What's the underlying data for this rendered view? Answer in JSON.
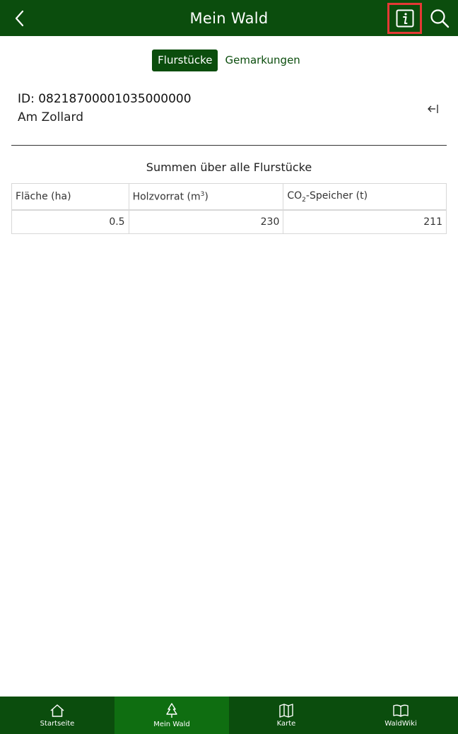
{
  "header": {
    "title": "Mein Wald",
    "back_icon": "chevron-left-icon",
    "info_icon": "info-icon",
    "search_icon": "search-icon"
  },
  "tabs": [
    {
      "label": "Flurstücke",
      "active": true
    },
    {
      "label": "Gemarkungen",
      "active": false
    }
  ],
  "parcel": {
    "id_text": "ID: 08218700001035000000",
    "name": "Am Zollard",
    "remove_icon": "remove-arrow-icon"
  },
  "summary": {
    "title": "Summen über alle Flurstücke",
    "columns": {
      "area": "Fläche (ha)",
      "wood_prefix": "Holzvorrat (m",
      "wood_sup": "3",
      "wood_suffix": ")",
      "co2_prefix": "CO",
      "co2_sub": "2",
      "co2_suffix": "-Speicher (t)"
    },
    "values": {
      "area": "0.5",
      "wood": "230",
      "co2": "211"
    }
  },
  "nav": [
    {
      "label": "Startseite",
      "icon": "home-icon",
      "active": false
    },
    {
      "label": "Mein Wald",
      "icon": "tree-icon",
      "active": true
    },
    {
      "label": "Karte",
      "icon": "map-icon",
      "active": false
    },
    {
      "label": "WaldWiki",
      "icon": "book-icon",
      "active": false
    }
  ],
  "colors": {
    "primary": "#0b4d0d",
    "nav_active": "#0f6e11",
    "highlight": "#e53935"
  }
}
